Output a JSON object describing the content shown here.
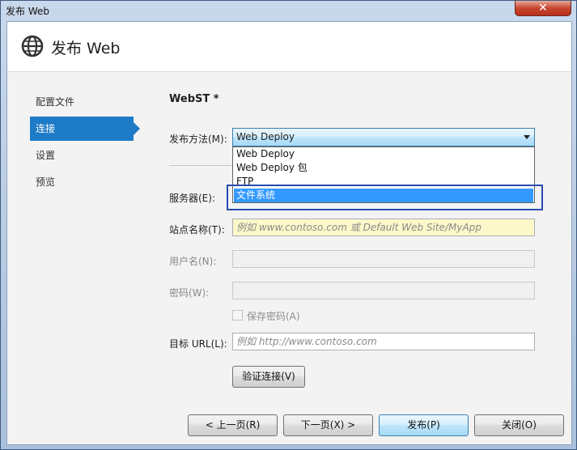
{
  "window": {
    "title": "发布 Web",
    "close_glyph": "✕"
  },
  "header": {
    "title": "发布 Web",
    "icon": "globe-icon"
  },
  "nav": {
    "items": [
      {
        "label": "配置文件",
        "active": false
      },
      {
        "label": "连接",
        "active": true
      },
      {
        "label": "设置",
        "active": false
      },
      {
        "label": "预览",
        "active": false
      }
    ]
  },
  "profile": {
    "name": "WebST *"
  },
  "form": {
    "publish_method": {
      "label": "发布方法(M):",
      "value": "Web Deploy",
      "options": [
        "Web Deploy",
        "Web Deploy 包",
        "FTP",
        "文件系统"
      ],
      "highlighted_option": "文件系统"
    },
    "server": {
      "label": "服务器(E):",
      "value": ""
    },
    "site_name": {
      "label": "站点名称(T):",
      "placeholder": "例如 www.contoso.com 或 Default Web Site/MyApp"
    },
    "username": {
      "label": "用户名(N):",
      "value": ""
    },
    "password": {
      "label": "密码(W):",
      "value": ""
    },
    "save_password": {
      "label": "保存密码(A)",
      "checked": false
    },
    "target_url": {
      "label": "目标 URL(L):",
      "placeholder": "例如 http://www.contoso.com"
    },
    "verify_button": "验证连接(V)"
  },
  "footer": {
    "prev": "< 上一页(R)",
    "next": "下一页(X) >",
    "publish": "发布(P)",
    "close": "关闭(O)"
  },
  "colors": {
    "accent": "#1e7bc7",
    "highlight": "#3399ff",
    "frame": "#2a4bb0"
  }
}
